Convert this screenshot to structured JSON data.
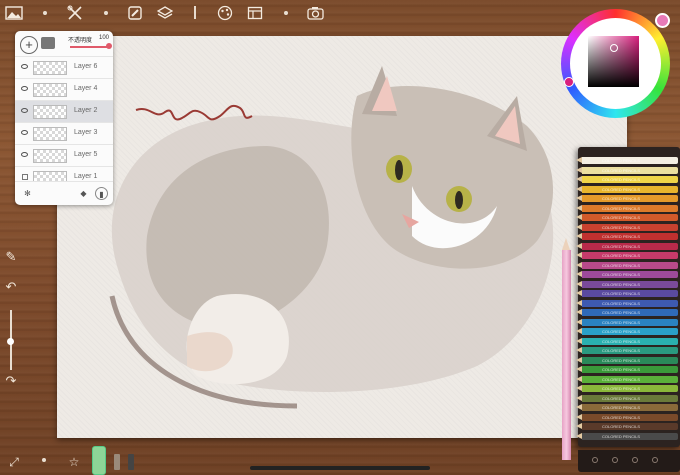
{
  "toolbar": {
    "items": [
      "gallery-icon",
      "tools-icon",
      "brush-icon",
      "layers-icon",
      "pen-icon",
      "palette-icon",
      "reference-icon",
      "camera-icon"
    ]
  },
  "layers_panel": {
    "opacity_label": "不透明度",
    "opacity_value": "100",
    "opacity_level": 1.0,
    "layers": [
      {
        "name": "Layer 6",
        "visible": true,
        "selected": false
      },
      {
        "name": "Layer 4",
        "visible": true,
        "selected": false
      },
      {
        "name": "Layer 2",
        "visible": true,
        "selected": true
      },
      {
        "name": "Layer 3",
        "visible": true,
        "selected": false
      },
      {
        "name": "Layer 5",
        "visible": true,
        "selected": false
      },
      {
        "name": "Layer 1",
        "visible": false,
        "selected": false
      }
    ]
  },
  "canvas": {
    "signature": "Mojinonofo"
  },
  "color_picker": {
    "current_color": "#d8207e",
    "swatch_color": "#e87ab8"
  },
  "pencil_box": {
    "label": "COLORED PENCILS",
    "colors": [
      "#f4efe3",
      "#ece0a0",
      "#f0d548",
      "#e8b52d",
      "#e59a2a",
      "#dd7a2a",
      "#d25a2a",
      "#c8412f",
      "#c0302f",
      "#b82a4a",
      "#c63a6a",
      "#b84a8a",
      "#9d4a9b",
      "#7a4a9a",
      "#5a4aa0",
      "#3e5ab0",
      "#2f6ab8",
      "#2a82c0",
      "#2aa0c8",
      "#2ab0b0",
      "#2a9a80",
      "#2a8a5a",
      "#3a9a3a",
      "#5ab03a",
      "#8ab83a",
      "#6a7a3a",
      "#8a6a3a",
      "#7a4a2a",
      "#5a3a2a",
      "#4a4a4a"
    ]
  }
}
